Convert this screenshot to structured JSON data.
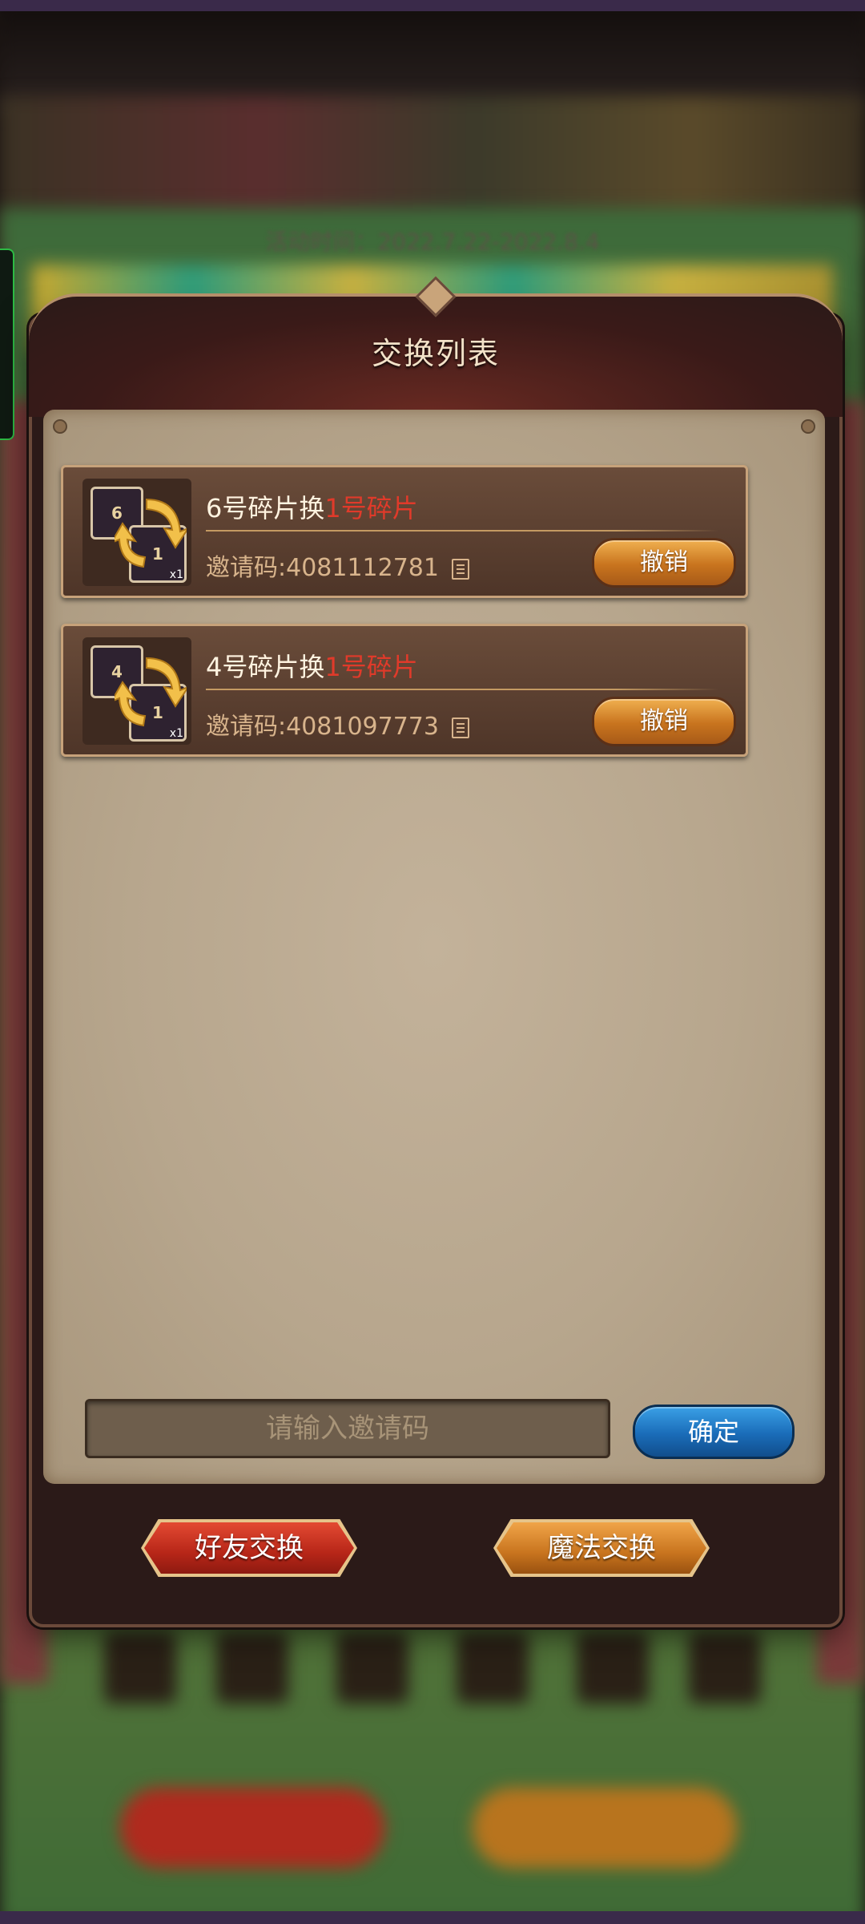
{
  "background": {
    "event_time": "活动时间：2022.7.22-2022.8.4"
  },
  "dialog": {
    "title": "交换列表",
    "rows": [
      {
        "from_piece": "6",
        "to_piece": "1",
        "from_label": "6号碎片换",
        "to_label": "1号碎片",
        "qty": "x1",
        "code": "邀请码:4081112781",
        "cancel_label": "撤销"
      },
      {
        "from_piece": "4",
        "to_piece": "1",
        "from_label": "4号碎片换",
        "to_label": "1号碎片",
        "qty": "x1",
        "code": "邀请码:4081097773",
        "cancel_label": "撤销"
      }
    ],
    "input": {
      "placeholder": "请输入邀请码",
      "value": ""
    },
    "confirm_label": "确定",
    "friend_exchange_label": "好友交换",
    "magic_exchange_label": "魔法交换"
  },
  "colors": {
    "accent_red": "#e03a2a",
    "button_orange": "#c8741e",
    "button_blue": "#1a6cb8",
    "button_red": "#b72618"
  }
}
